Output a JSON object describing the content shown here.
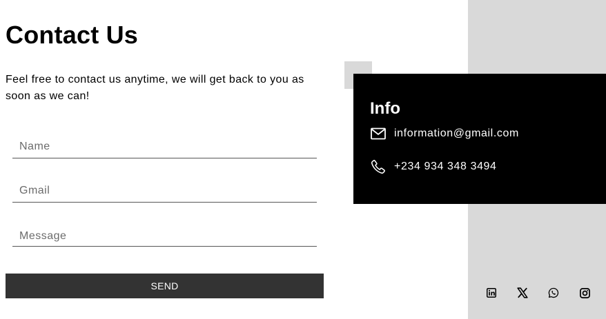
{
  "page": {
    "title": "Contact Us",
    "subtitle": "Feel free to contact us anytime, we will get back to you as soon as we can!"
  },
  "form": {
    "name_placeholder": "Name",
    "gmail_placeholder": "Gmail",
    "message_placeholder": "Message",
    "send_label": "SEND"
  },
  "info": {
    "title": "Info",
    "email": "information@gmail.com",
    "phone": "+234 934 348 3494",
    "email_icon": "mail-icon",
    "phone_icon": "phone-icon"
  },
  "socials": [
    "linkedin-icon",
    "x-icon",
    "whatsapp-icon",
    "instagram-icon"
  ],
  "colors": {
    "background": "#ffffff",
    "panel": "#d9d9d9",
    "info_card": "#000000",
    "button": "#333333",
    "button_text": "#ffffff"
  }
}
